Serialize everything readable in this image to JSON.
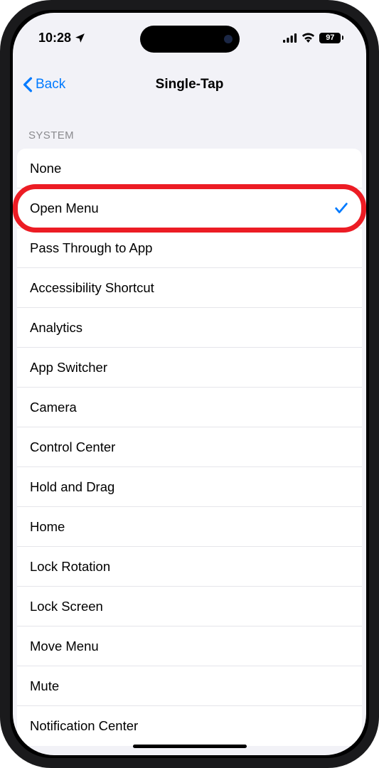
{
  "status": {
    "time": "10:28",
    "battery_pct": "97"
  },
  "nav": {
    "back_label": "Back",
    "title": "Single-Tap"
  },
  "section": {
    "header": "SYSTEM",
    "items": [
      {
        "label": "None",
        "selected": false
      },
      {
        "label": "Open Menu",
        "selected": true
      },
      {
        "label": "Pass Through to App",
        "selected": false
      },
      {
        "label": "Accessibility Shortcut",
        "selected": false
      },
      {
        "label": "Analytics",
        "selected": false
      },
      {
        "label": "App Switcher",
        "selected": false
      },
      {
        "label": "Camera",
        "selected": false
      },
      {
        "label": "Control Center",
        "selected": false
      },
      {
        "label": "Hold and Drag",
        "selected": false
      },
      {
        "label": "Home",
        "selected": false
      },
      {
        "label": "Lock Rotation",
        "selected": false
      },
      {
        "label": "Lock Screen",
        "selected": false
      },
      {
        "label": "Move Menu",
        "selected": false
      },
      {
        "label": "Mute",
        "selected": false
      },
      {
        "label": "Notification Center",
        "selected": false
      }
    ]
  },
  "highlight_index": 1
}
